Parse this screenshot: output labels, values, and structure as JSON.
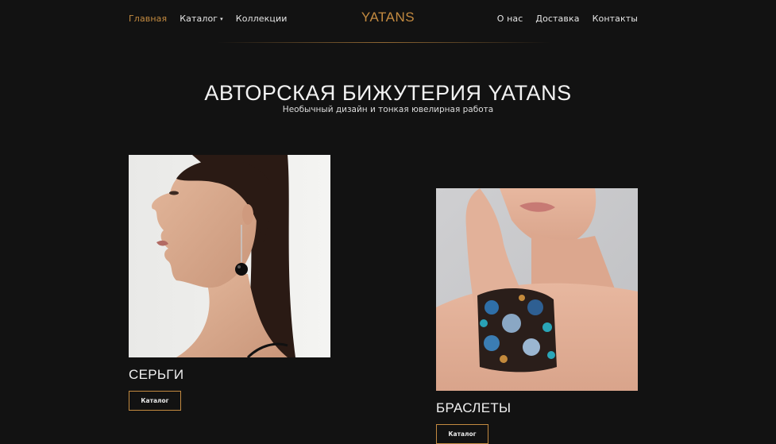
{
  "header": {
    "logo": "YATANS",
    "nav_left": [
      {
        "label": "Главная",
        "active": true
      },
      {
        "label": "Каталог",
        "has_dropdown": true
      },
      {
        "label": "Коллекции"
      }
    ],
    "nav_right": [
      {
        "label": "О нас"
      },
      {
        "label": "Доставка"
      },
      {
        "label": "Контакты"
      }
    ]
  },
  "hero": {
    "title": "АВТОРСКАЯ БИЖУТЕРИЯ YATANS",
    "subtitle": "Необычный дизайн и тонкая ювелирная работа"
  },
  "categories": [
    {
      "title": "СЕРЬГИ",
      "button": "Каталог",
      "image_icon": "earring-model-photo"
    },
    {
      "title": "БРАСЛЕТЫ",
      "button": "Каталог",
      "image_icon": "bracelet-model-photo"
    }
  ],
  "colors": {
    "background": "#121212",
    "accent": "#c38a40",
    "text": "#e8e8e8"
  }
}
